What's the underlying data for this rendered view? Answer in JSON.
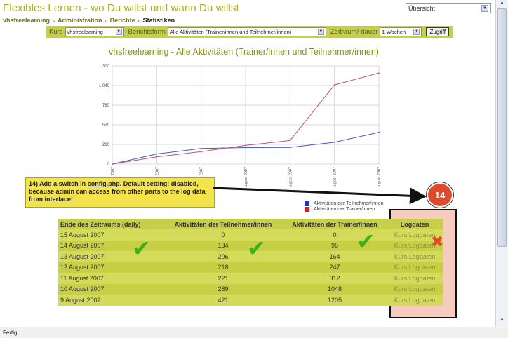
{
  "header": {
    "title": "Flexibles Lernen - wo Du willst und wann Du willst",
    "top_select_value": "Übersicht"
  },
  "breadcrumb": {
    "items": [
      "vhsfreelearning",
      "Administration",
      "Berichte",
      "Statistiken"
    ]
  },
  "filters": {
    "course_label": "Kurs",
    "course_value": "vhsfreelearning",
    "report_label": "Berichtsform",
    "report_value": "Alle Aktivitäten (Trainer/innen und Teilnehmer/innen)",
    "period_label": "Zeitraum/-dauer",
    "period_value": "1 Wochen",
    "go_label": "Zugriff"
  },
  "chart_title": "vhsfreelearning - Alle Aktivitäten (Trainer/innen und Teilnehmer/innen)",
  "chart_data": {
    "type": "line",
    "title": "vhsfreelearning - Alle Aktivitäten (Trainer/innen und Teilnehmer/innen)",
    "x": [
      "9 August 2007",
      "10 August 2007",
      "11 August 2007",
      "12 August 2007",
      "13 August 2007",
      "14 August 2007",
      "15 August 2007"
    ],
    "series": [
      {
        "name": "Aktivitäten der Teilnehmer/innen",
        "color": "#4455cc",
        "values": [
          421,
          289,
          221,
          218,
          206,
          134,
          0
        ]
      },
      {
        "name": "Aktivitäten der Trainer/innen",
        "color": "#bb5566",
        "values": [
          1205,
          1048,
          312,
          247,
          164,
          96,
          0
        ]
      }
    ],
    "y_ticks": [
      "0",
      "260",
      "520",
      "780",
      "1,040",
      "1,300"
    ],
    "ylim": [
      0,
      1300
    ],
    "grid": true,
    "legend_position": "bottom-right"
  },
  "legend": {
    "items": [
      {
        "label": "Aktivitäten der Teilnehmer/innen",
        "color": "#2233cc"
      },
      {
        "label": "Aktivitäten der Trainer/innen",
        "color": "#cc2222"
      }
    ]
  },
  "annotation": {
    "text_before": "14) Add a switch in ",
    "text_file": "config.php",
    "text_after": ". Default setting: disabled, because admin can access from other parts to the log data from interface!",
    "badge": "14"
  },
  "table": {
    "headers": [
      "Ende des Zeitraums (daily)",
      "Aktivitäten der Teilnehmer/innen",
      "Aktivitäten der Trainer/innen",
      "Logdaten"
    ],
    "rows": [
      [
        "15 August 2007",
        "0",
        "0",
        "Kurs Logdaten"
      ],
      [
        "14 August 2007",
        "134",
        "96",
        "Kurs Logdaten"
      ],
      [
        "13 August 2007",
        "206",
        "164",
        "Kurs Logdaten"
      ],
      [
        "12 August 2007",
        "218",
        "247",
        "Kurs Logdaten"
      ],
      [
        "11 August 2007",
        "221",
        "312",
        "Kurs Logdaten"
      ],
      [
        "10 August 2007",
        "289",
        "1048",
        "Kurs Logdaten"
      ],
      [
        "9 August 2007",
        "421",
        "1205",
        "Kurs Logdaten"
      ]
    ]
  },
  "icons": {
    "check": "check-icon",
    "cross": "cross-icon"
  },
  "status_bar": "Fertig"
}
